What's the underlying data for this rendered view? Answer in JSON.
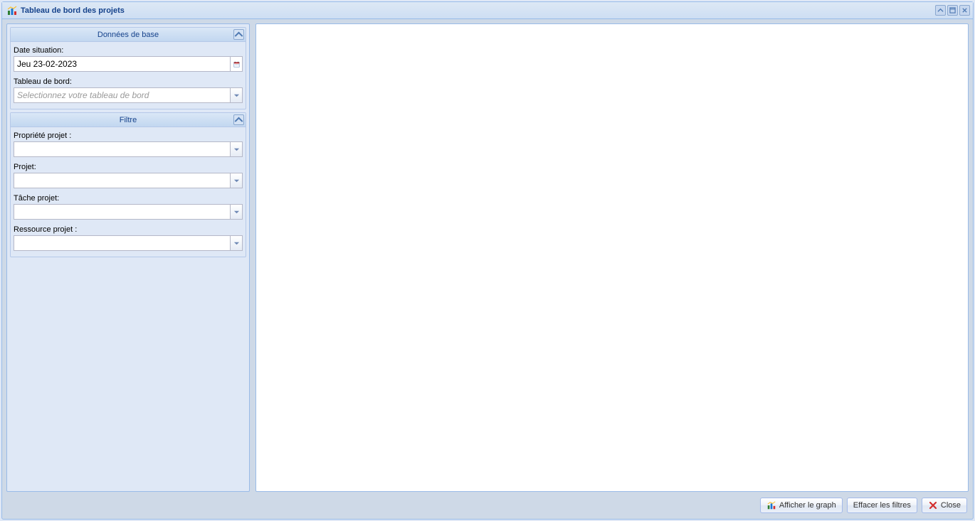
{
  "window": {
    "title": "Tableau de bord des projets"
  },
  "sidebar": {
    "fieldsets": {
      "base": {
        "title": "Données de base",
        "date_label": "Date situation:",
        "date_value": "Jeu 23-02-2023",
        "dashboard_label": "Tableau de bord:",
        "dashboard_placeholder": "Selectionnez votre tableau de bord",
        "dashboard_value": ""
      },
      "filter": {
        "title": "Filtre",
        "prop_label": "Propriété projet :",
        "prop_value": "",
        "project_label": "Projet:",
        "project_value": "",
        "task_label": "Tâche projet:",
        "task_value": "",
        "resource_label": "Ressource projet :",
        "resource_value": ""
      }
    }
  },
  "footer": {
    "show_graph": "Afficher le graph",
    "clear_filters": "Effacer les filtres",
    "close": "Close"
  }
}
